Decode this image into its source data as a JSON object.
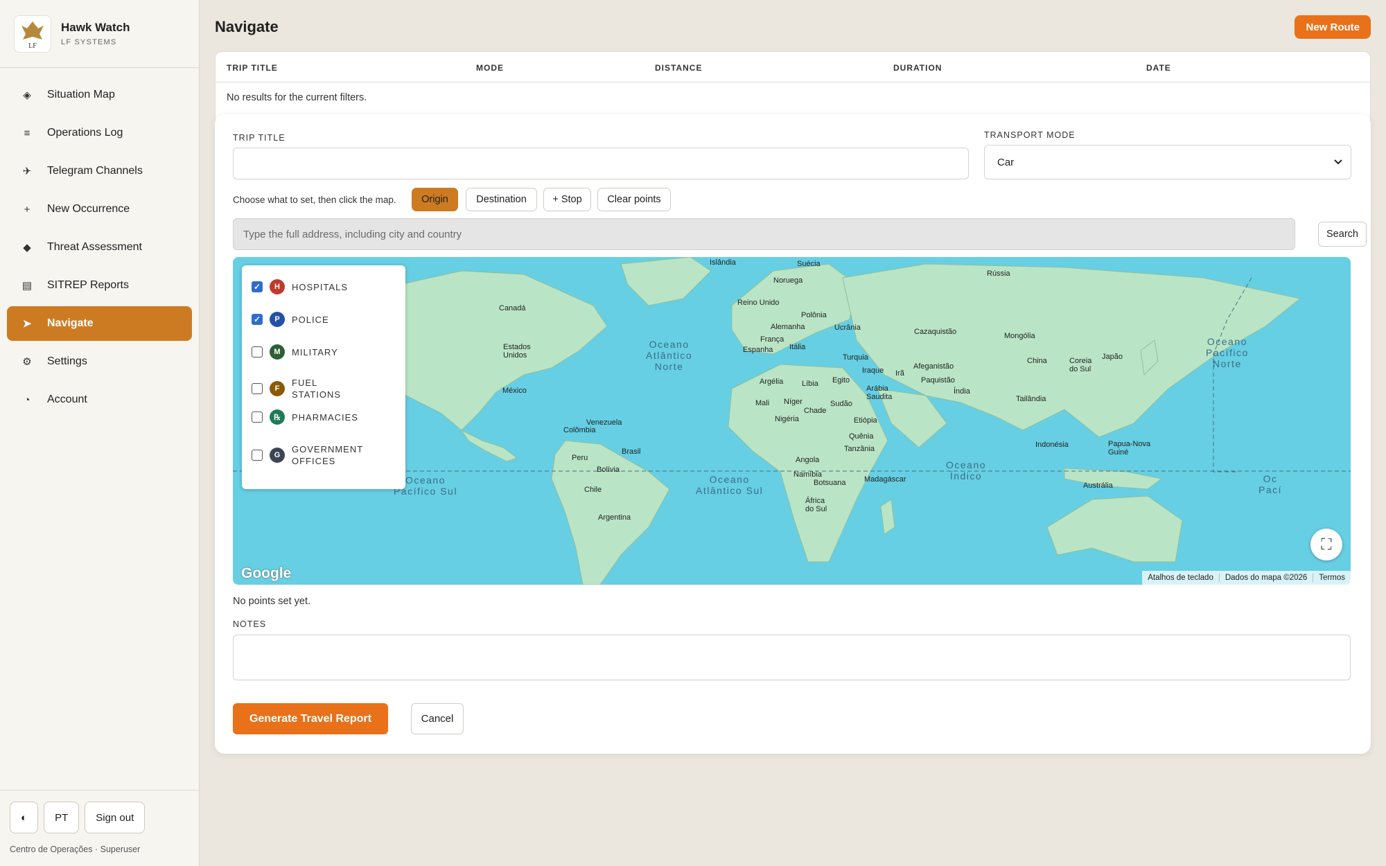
{
  "app": {
    "name": "Hawk Watch",
    "subtitle": "LF SYSTEMS",
    "logo_text": "LF"
  },
  "sidebar": {
    "items": [
      {
        "label": "Situation Map",
        "icon": "diamond-outline-icon",
        "glyph": "◈"
      },
      {
        "label": "Operations Log",
        "icon": "list-icon",
        "glyph": "≡"
      },
      {
        "label": "Telegram Channels",
        "icon": "plane-icon",
        "glyph": "✈"
      },
      {
        "label": "New Occurrence",
        "icon": "plus-icon",
        "glyph": "+"
      },
      {
        "label": "Threat Assessment",
        "icon": "diamond-icon",
        "glyph": "◆"
      },
      {
        "label": "SITREP Reports",
        "icon": "report-icon",
        "glyph": "▤"
      },
      {
        "label": "Navigate",
        "icon": "navigate-arrow-icon",
        "glyph": "➤",
        "active": true
      },
      {
        "label": "Settings",
        "icon": "gear-icon",
        "glyph": "⚙"
      },
      {
        "label": "Account",
        "icon": "account-icon",
        "glyph": "◔"
      }
    ],
    "footer": {
      "theme_glyph": "◐",
      "language": "PT",
      "sign_out": "Sign out",
      "caption": "Centro de Operações · Superuser"
    }
  },
  "header": {
    "title": "Navigate",
    "new_route_label": "New Route"
  },
  "trips_table": {
    "columns": [
      "TRIP TITLE",
      "MODE",
      "DISTANCE",
      "DURATION",
      "DATE"
    ],
    "empty_message": "No results for the current filters."
  },
  "form": {
    "trip_title_label": "TRIP TITLE",
    "trip_title_value": "",
    "transport_mode_label": "TRANSPORT MODE",
    "transport_mode_value": "Car",
    "point_hint": "Choose what to set, then click the map.",
    "point_buttons": {
      "origin": "Origin",
      "destination": "Destination",
      "stop": "+ Stop",
      "clear": "Clear points"
    },
    "active_point_button": "Origin",
    "address_placeholder": "Type the full address, including city and country",
    "search_label": "Search",
    "points_status": "No points set yet.",
    "notes_label": "NOTES",
    "notes_value": "",
    "generate_label": "Generate Travel Report",
    "cancel_label": "Cancel"
  },
  "map": {
    "layers": [
      {
        "label": "HOSPITALS",
        "badge": "H",
        "color": "#c0392b",
        "checked": true
      },
      {
        "label": "POLICE",
        "badge": "P",
        "color": "#2450a6",
        "checked": true
      },
      {
        "label": "MILITARY",
        "badge": "M",
        "color": "#2e5e36",
        "checked": false
      },
      {
        "label": "FUEL STATIONS",
        "badge": "F",
        "color": "#8a5a08",
        "checked": false
      },
      {
        "label": "PHARMACIES",
        "badge": "℞",
        "color": "#1f7a58",
        "checked": false
      },
      {
        "label": "GOVERNMENT OFFICES",
        "badge": "G",
        "color": "#3d4455",
        "checked": false
      }
    ],
    "place_labels": {
      "islandia": "Islândia",
      "suecia": "Suécia",
      "russia": "Rússia",
      "noruega": "Noruega",
      "canada": "Canadá",
      "reino_unido": "Reino Unido",
      "polonia": "Polônia",
      "alemanha": "Alemanha",
      "ucrania": "Ucrânia",
      "cazaquistao": "Cazaquistão",
      "mongolia": "Mongólia",
      "franca": "França",
      "italia": "Itália",
      "espanha": "Espanha",
      "eua": "Estados\nUnidos",
      "turquia": "Turquia",
      "japao": "Japão",
      "china": "China",
      "coreia": "Coreia\ndo Sul",
      "iraque": "Iraque",
      "ira": "Irã",
      "afeganistao": "Afeganistão",
      "paquistao": "Paquistão",
      "argelia": "Argélia",
      "libia": "Líbia",
      "egito": "Egito",
      "mexico": "México",
      "arabia": "Arábia\nSaudita",
      "india": "Índia",
      "tailandia": "Tailândia",
      "mali": "Mali",
      "niger": "Níger",
      "sudao": "Sudão",
      "chade": "Chade",
      "nigeria": "Nigéria",
      "etiopia": "Etiópia",
      "venezuela": "Venezuela",
      "colombia": "Colômbia",
      "quenia": "Quênia",
      "indonesia": "Indonésia",
      "papua": "Papua-Nova\nGuiné",
      "brasil": "Brasil",
      "tanzania": "Tanzânia",
      "peru": "Peru",
      "bolivia": "Bolívia",
      "angola": "Angola",
      "namibia": "Namíbia",
      "madagascar": "Madagáscar",
      "botsuana": "Botsuana",
      "australia": "Austrália",
      "chile": "Chile",
      "africa_sul": "África\ndo Sul",
      "argentina": "Argentina"
    },
    "ocean_labels": {
      "atl_norte": "Oceano\nAtlântico\nNorte",
      "pac_norte": "Oceano\nPacífico\nNorte",
      "pac_sul": "Oceano\nPacífico Sul",
      "atl_sul": "Oceano\nAtlântico Sul",
      "indico": "Oceano\nÍndico",
      "pac_sul_right": "Oc\nPací"
    },
    "google_logo": "Google",
    "attribution": {
      "shortcuts": "Atalhos de teclado",
      "data": "Dados do mapa ©2026",
      "terms": "Termos"
    },
    "fullscreen_glyph": "⛶"
  },
  "colors": {
    "accent_orange": "#e8711a",
    "active_nav": "#cd7b22",
    "ocean": "#66cfe3",
    "land": "#b9e5c6"
  }
}
